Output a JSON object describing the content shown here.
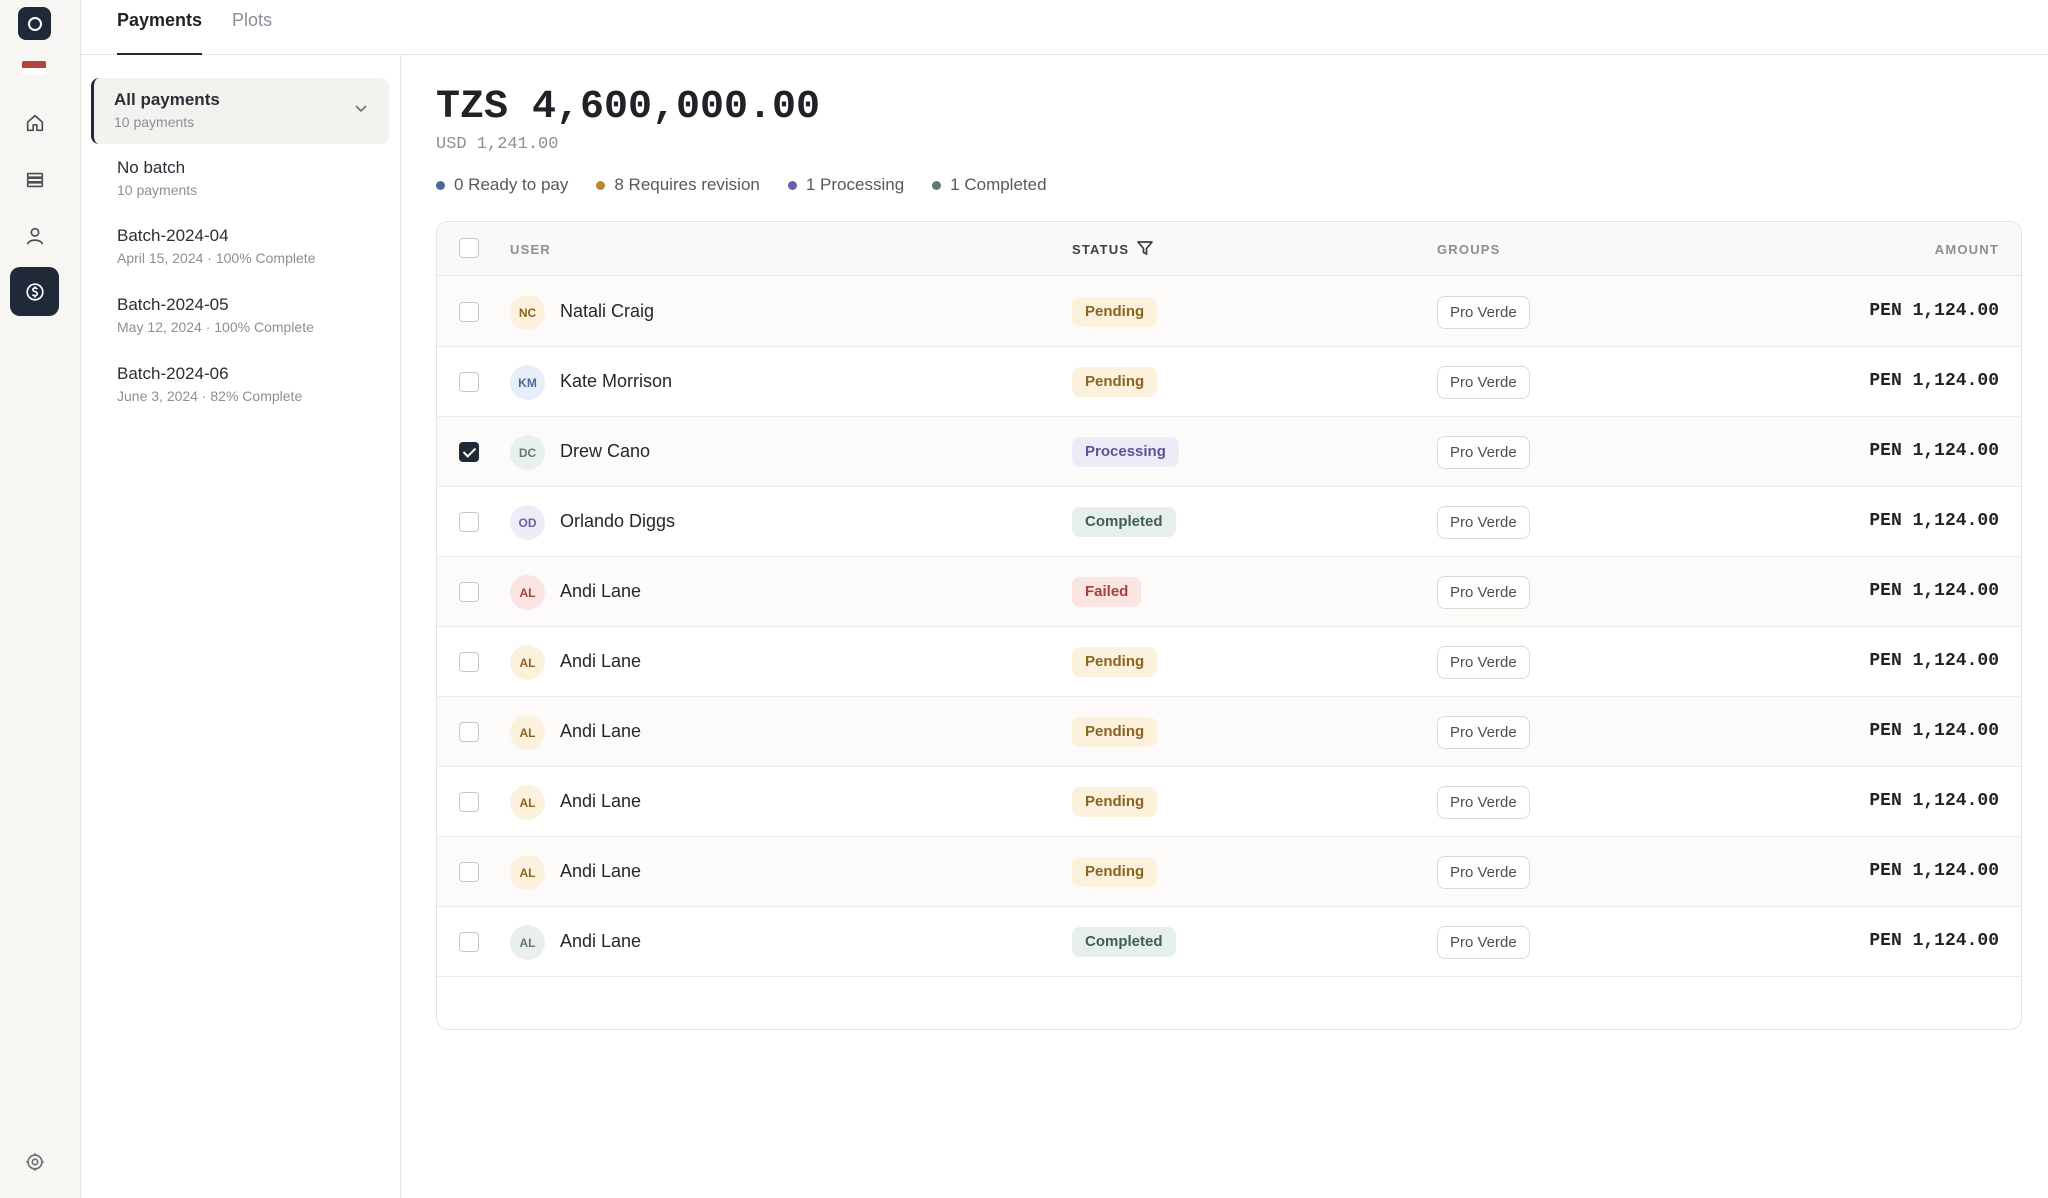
{
  "colors": {
    "accent": "#1f2937",
    "ready": "#4b6a9b",
    "revision": "#b8892e",
    "processing": "#6b5fa7",
    "completed": "#5e7a73"
  },
  "nav": {
    "logo_icon": "circle-logo-icon",
    "flag_colors": [
      "#b5423b",
      "#ffffff"
    ],
    "items": [
      {
        "name": "home-icon",
        "active": false
      },
      {
        "name": "stack-icon",
        "active": false
      },
      {
        "name": "user-icon",
        "active": false
      },
      {
        "name": "dollar-icon",
        "active": true
      }
    ],
    "settings_icon": "settings-icon"
  },
  "tabs": [
    {
      "label": "Payments",
      "active": true
    },
    {
      "label": "Plots",
      "active": false
    }
  ],
  "batches": [
    {
      "title": "All payments",
      "subtitle": "10 payments",
      "active": true
    },
    {
      "title": "No batch",
      "subtitle": "10 payments",
      "active": false
    },
    {
      "title": "Batch-2024-04",
      "subtitle": "April 15, 2024 · 100% Complete",
      "active": false
    },
    {
      "title": "Batch-2024-05",
      "subtitle": "May 12, 2024 · 100% Complete",
      "active": false
    },
    {
      "title": "Batch-2024-06",
      "subtitle": "June 3, 2024 · 82% Complete",
      "active": false
    }
  ],
  "summary": {
    "total": "TZS 4,600,000.00",
    "converted": "USD 1,241.00",
    "legend": [
      {
        "label": "0 Ready to pay",
        "color": "#4b6a9b"
      },
      {
        "label": "8 Requires revision",
        "color": "#b8892e"
      },
      {
        "label": "1 Processing",
        "color": "#6b5fa7"
      },
      {
        "label": "1 Completed",
        "color": "#5e7a73"
      }
    ]
  },
  "table": {
    "headers": {
      "user": "USER",
      "status": "STATUS",
      "groups": "GROUPS",
      "amount": "AMOUNT"
    },
    "rows": [
      {
        "initials": "NC",
        "name": "Natali Craig",
        "status": "Pending",
        "group": "Pro Verde",
        "amount": "PEN 1,124.00",
        "checked": false
      },
      {
        "initials": "KM",
        "name": "Kate Morrison",
        "status": "Pending",
        "group": "Pro Verde",
        "amount": "PEN 1,124.00",
        "checked": false
      },
      {
        "initials": "DC",
        "name": "Drew Cano",
        "status": "Processing",
        "group": "Pro Verde",
        "amount": "PEN 1,124.00",
        "checked": true
      },
      {
        "initials": "OD",
        "name": "Orlando Diggs",
        "status": "Completed",
        "group": "Pro Verde",
        "amount": "PEN 1,124.00",
        "checked": false
      },
      {
        "initials": "AL",
        "name": "Andi Lane",
        "status": "Failed",
        "group": "Pro Verde",
        "amount": "PEN 1,124.00",
        "checked": false
      },
      {
        "initials": "AL",
        "name": "Andi Lane",
        "status": "Pending",
        "group": "Pro Verde",
        "amount": "PEN 1,124.00",
        "checked": false
      },
      {
        "initials": "AL",
        "name": "Andi Lane",
        "status": "Pending",
        "group": "Pro Verde",
        "amount": "PEN 1,124.00",
        "checked": false
      },
      {
        "initials": "AL",
        "name": "Andi Lane",
        "status": "Pending",
        "group": "Pro Verde",
        "amount": "PEN 1,124.00",
        "checked": false
      },
      {
        "initials": "AL",
        "name": "Andi Lane",
        "status": "Pending",
        "group": "Pro Verde",
        "amount": "PEN 1,124.00",
        "checked": false
      },
      {
        "initials": "AL",
        "name": "Andi Lane",
        "status": "Completed",
        "group": "Pro Verde",
        "amount": "PEN 1,124.00",
        "checked": false
      }
    ]
  }
}
